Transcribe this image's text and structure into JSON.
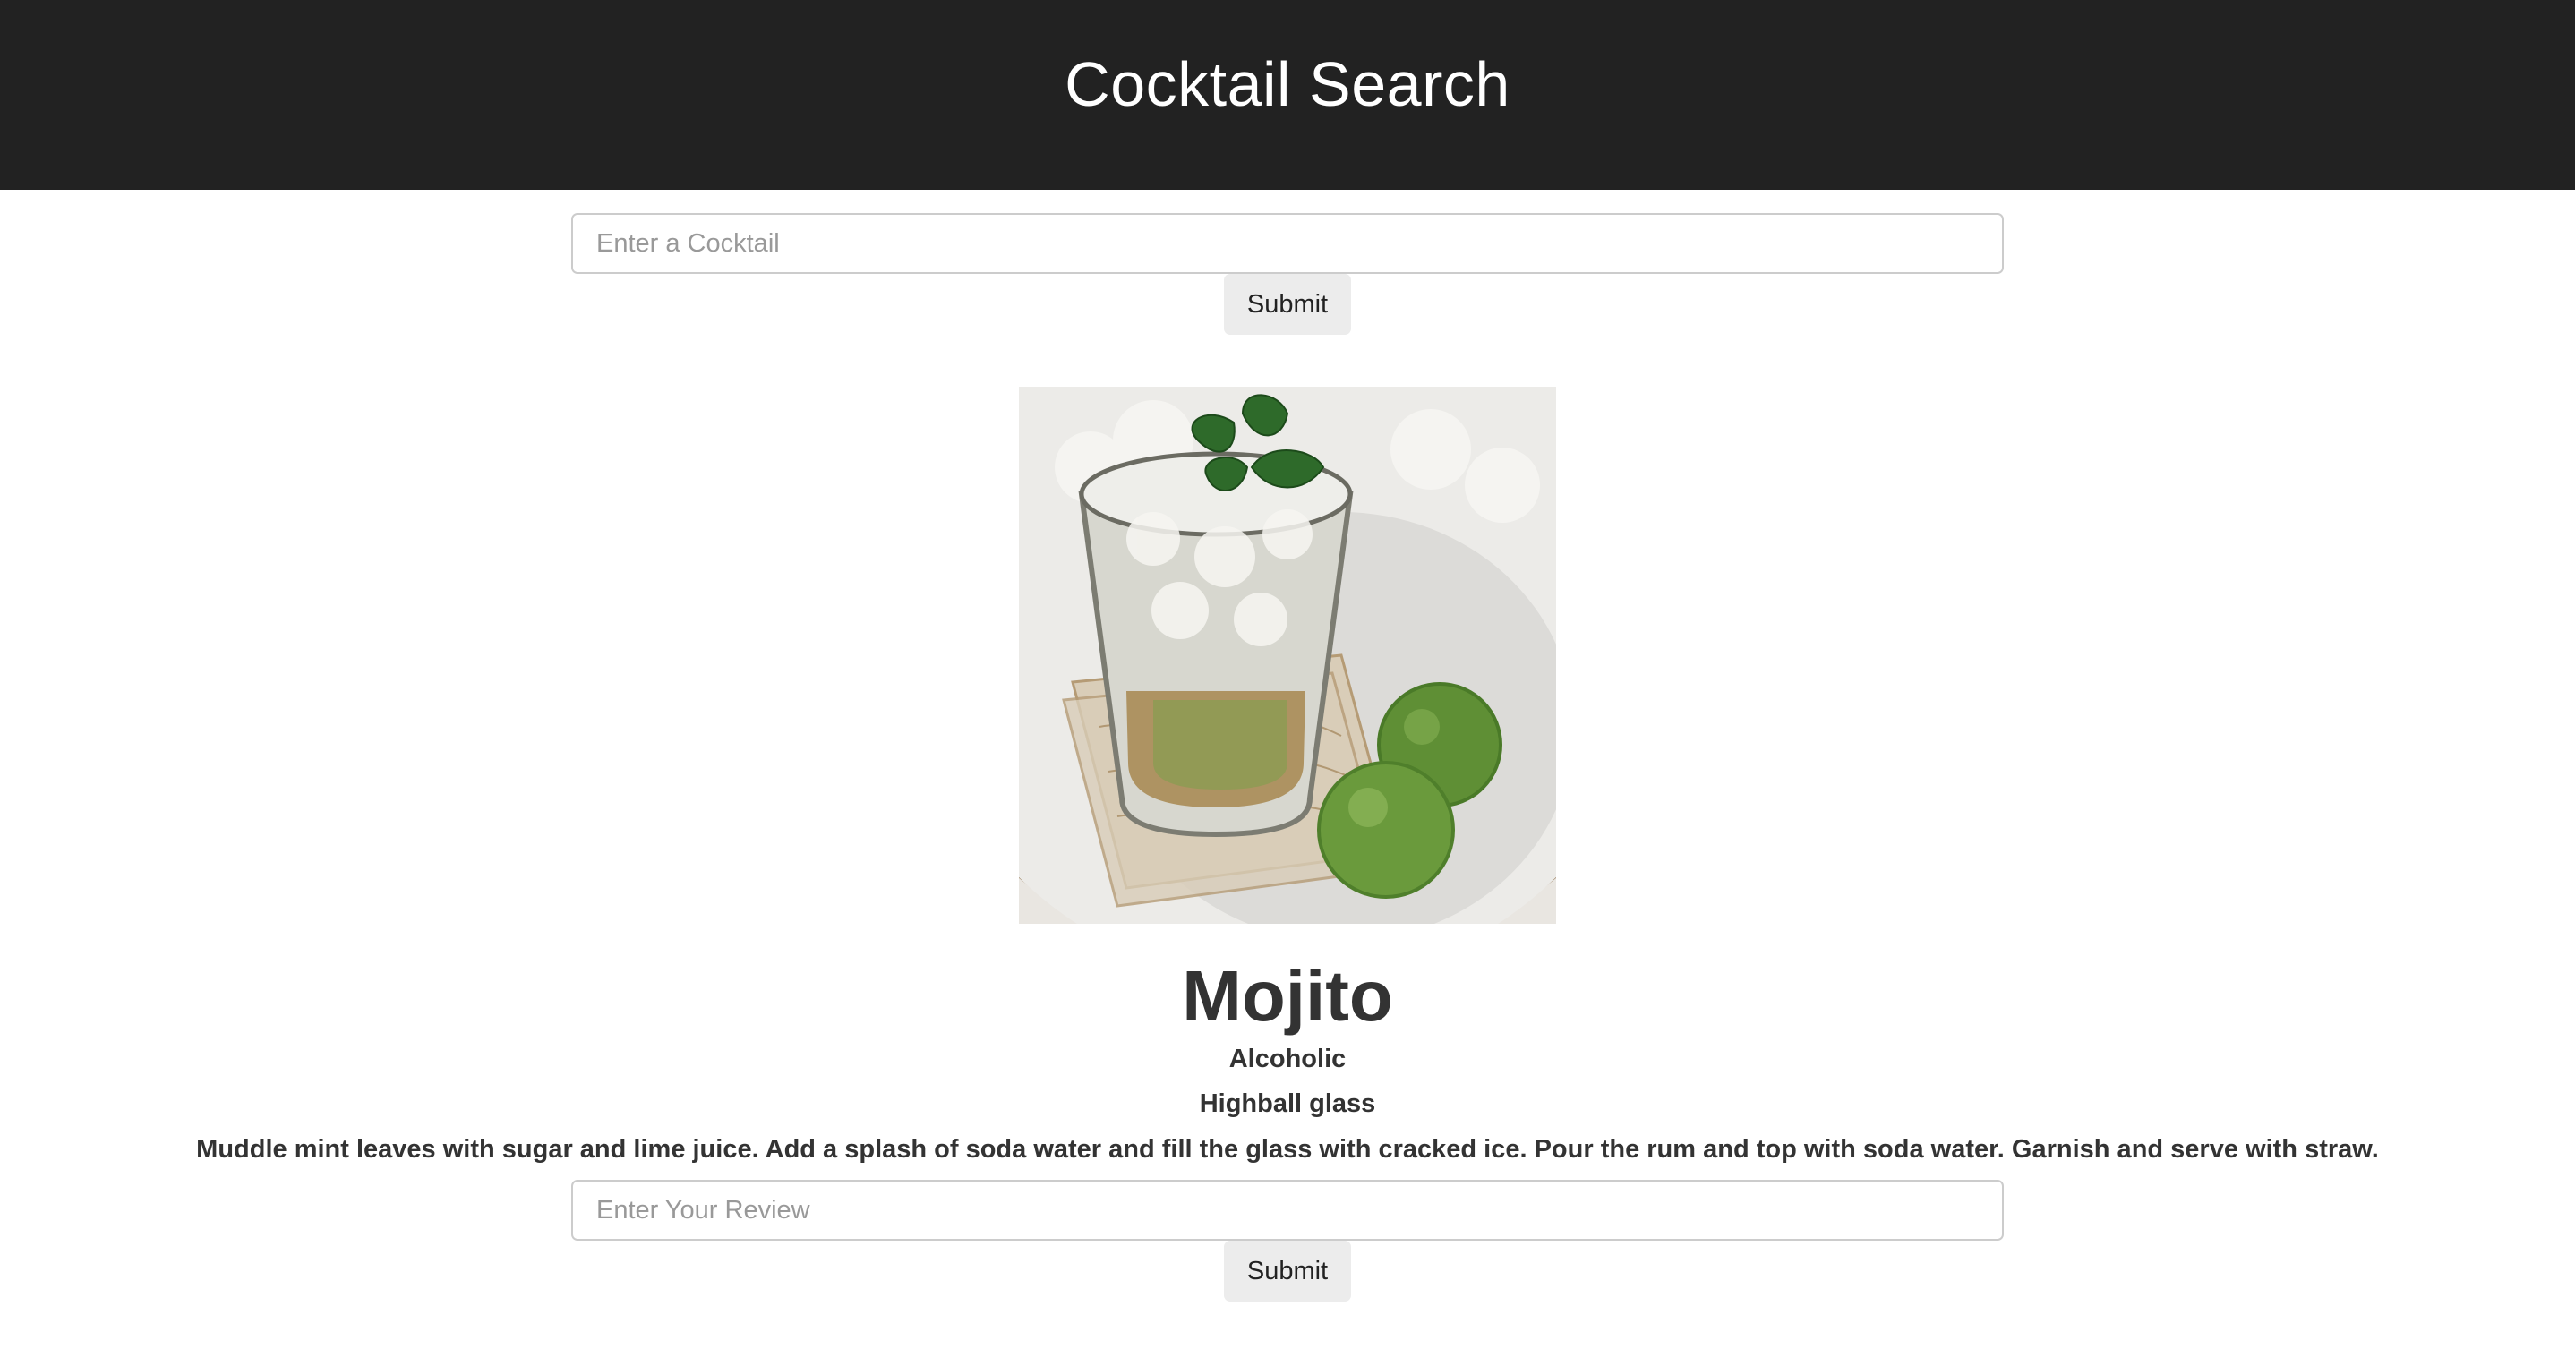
{
  "header": {
    "title": "Cocktail Search"
  },
  "search": {
    "placeholder": "Enter a Cocktail",
    "value": "",
    "submit_label": "Submit"
  },
  "cocktail": {
    "name": "Mojito",
    "alcoholic": "Alcoholic",
    "glass": "Highball glass",
    "instructions": "Muddle mint leaves with sugar and lime juice. Add a splash of soda water and fill the glass with cracked ice. Pour the rum and top with soda water. Garnish and serve with straw."
  },
  "review": {
    "placeholder": "Enter Your Review",
    "value": "",
    "submit_label": "Submit"
  },
  "colors": {
    "header_bg": "#222222",
    "button_bg": "#ececec",
    "text": "#333333"
  }
}
